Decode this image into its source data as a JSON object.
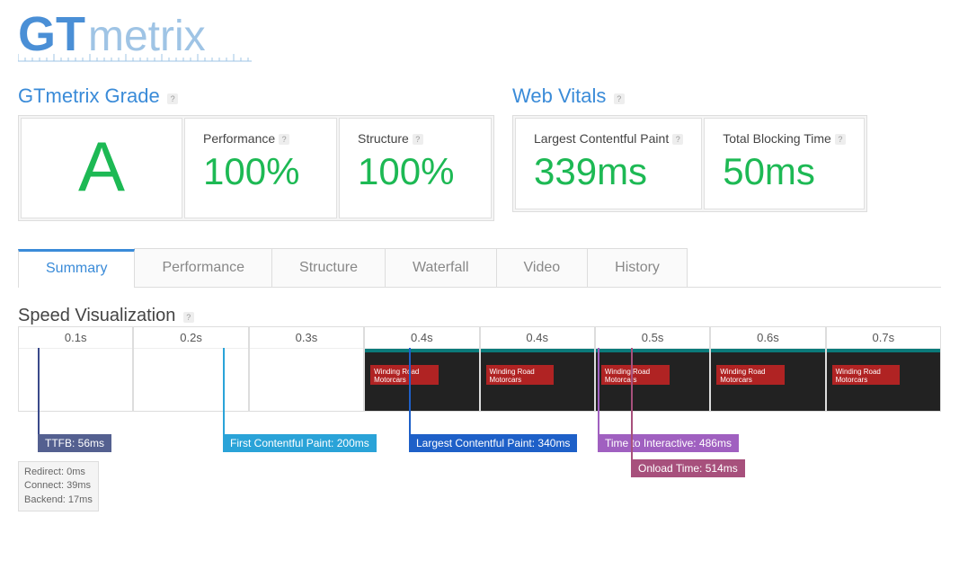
{
  "logo": {
    "gt": "GT",
    "metrix": "metrix"
  },
  "grade_section": {
    "title": "GTmetrix Grade",
    "grade": "A",
    "performance_label": "Performance",
    "performance_value": "100%",
    "structure_label": "Structure",
    "structure_value": "100%"
  },
  "vitals_section": {
    "title": "Web Vitals",
    "lcp_label": "Largest Contentful Paint",
    "lcp_value": "339ms",
    "tbt_label": "Total Blocking Time",
    "tbt_value": "50ms"
  },
  "tabs": {
    "summary": "Summary",
    "performance": "Performance",
    "structure": "Structure",
    "waterfall": "Waterfall",
    "video": "Video",
    "history": "History"
  },
  "speed": {
    "title": "Speed Visualization",
    "frame_caption": "Winding Road\nMotorcars",
    "times": [
      "0.1s",
      "0.2s",
      "0.3s",
      "0.4s",
      "0.4s",
      "0.5s",
      "0.6s",
      "0.7s"
    ],
    "markers": {
      "ttfb": "TTFB: 56ms",
      "fcp": "First Contentful Paint: 200ms",
      "lcp": "Largest Contentful Paint: 340ms",
      "tti": "Time to Interactive: 486ms",
      "onload": "Onload Time: 514ms"
    },
    "ttfb_details": {
      "redirect": "Redirect: 0ms",
      "connect": "Connect: 39ms",
      "backend": "Backend: 17ms"
    }
  }
}
